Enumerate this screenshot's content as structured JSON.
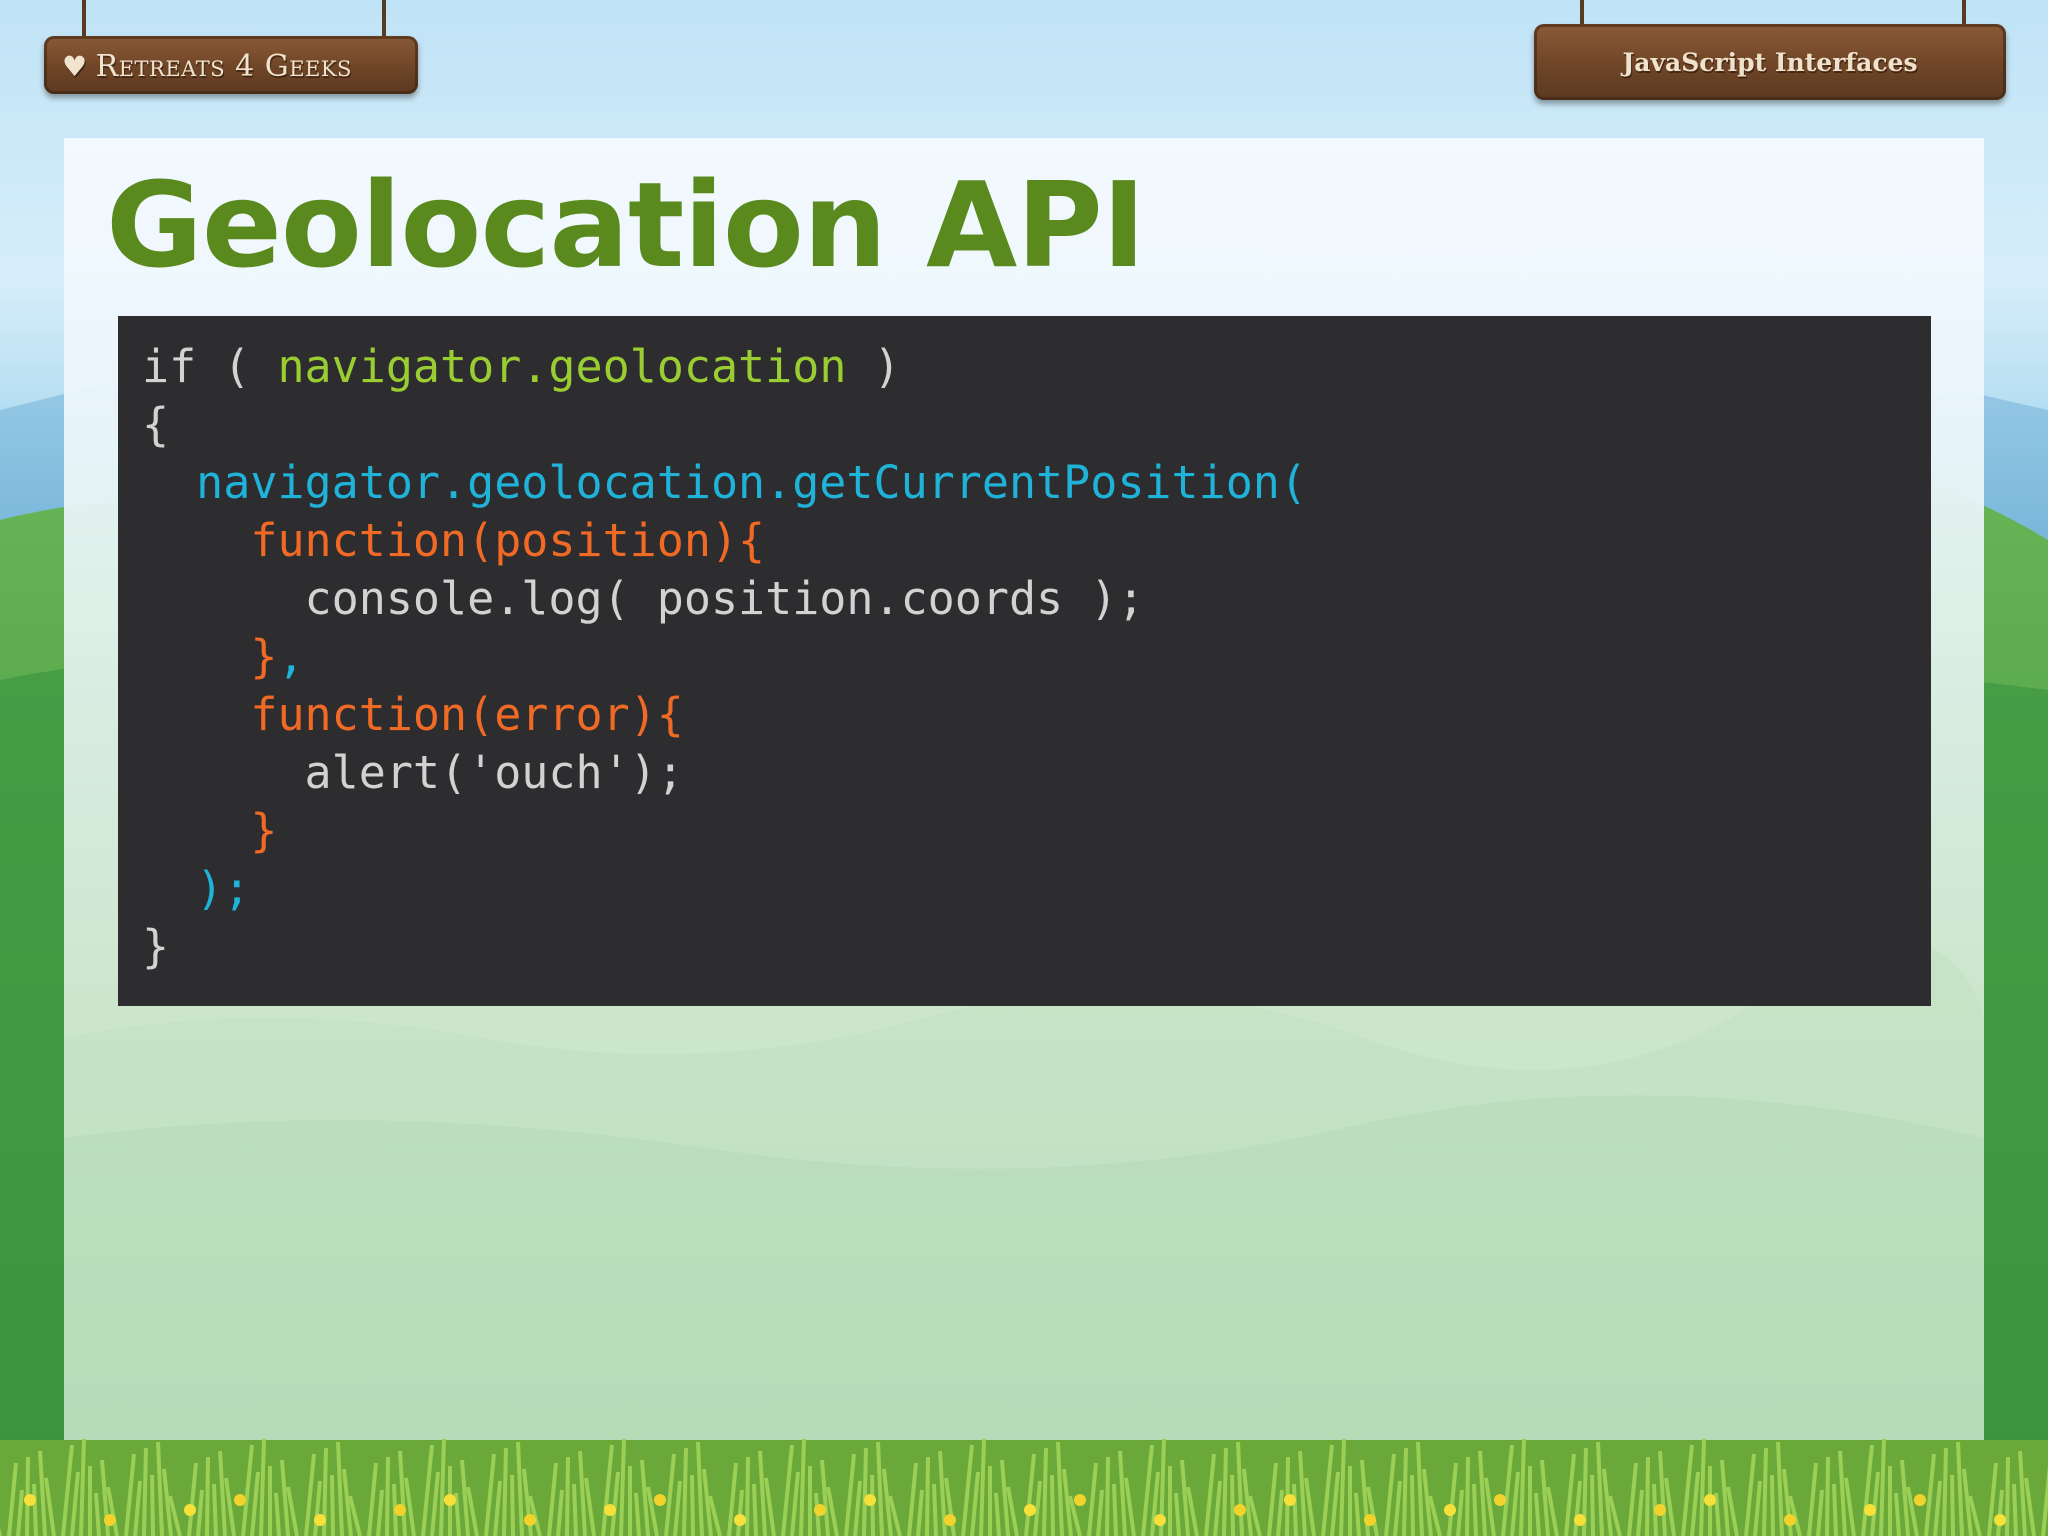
{
  "header": {
    "logo_text": "Retreats 4 Geeks",
    "section_title": "JavaScript Interfaces"
  },
  "slide": {
    "title": "Geolocation API"
  },
  "code": {
    "lines": [
      [
        {
          "t": "if ( ",
          "c": "plain"
        },
        {
          "t": "navigator.geolocation",
          "c": "green"
        },
        {
          "t": " )",
          "c": "plain"
        }
      ],
      [
        {
          "t": "{",
          "c": "plain"
        }
      ],
      [
        {
          "t": "  navigator.geolocation.getCurrentPosition(",
          "c": "cyan"
        }
      ],
      [
        {
          "t": "    function(position){",
          "c": "orange"
        }
      ],
      [
        {
          "t": "      console.log( position.coords );",
          "c": "plain"
        }
      ],
      [
        {
          "t": "    }",
          "c": "orange"
        },
        {
          "t": ",",
          "c": "cyan"
        }
      ],
      [
        {
          "t": "    function(error){",
          "c": "orange"
        }
      ],
      [
        {
          "t": "      alert('ouch');",
          "c": "plain"
        }
      ],
      [
        {
          "t": "    }",
          "c": "orange"
        }
      ],
      [
        {
          "t": "  );",
          "c": "cyan"
        }
      ],
      [
        {
          "t": "}",
          "c": "plain"
        }
      ]
    ]
  },
  "icons": {
    "logo_heart": "heart-icon"
  },
  "colors": {
    "title": "#5a8a1e",
    "code_background": "#2d2d2f",
    "code_plain": "#d2d2d2",
    "code_green": "#9acd32",
    "code_cyan": "#1fb3d9",
    "code_orange": "#f06a26"
  }
}
